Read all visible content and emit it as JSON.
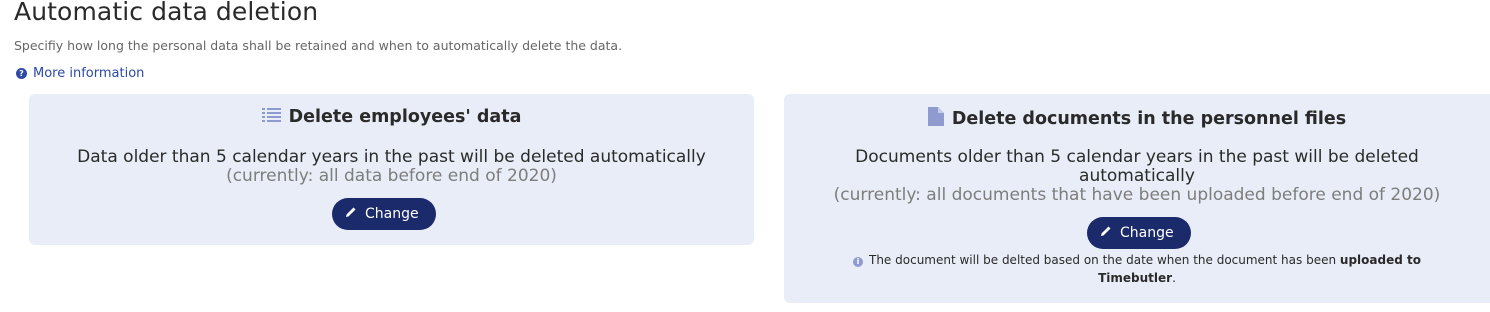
{
  "header": {
    "title": "Automatic data deletion",
    "subtitle": "Specifiy how long the personal data shall be retained and when to automatically delete the data.",
    "more_info_label": "More information",
    "more_info_icon": "question-circle-icon"
  },
  "cards": {
    "employees": {
      "icon": "list-icon",
      "title": "Delete employees' data",
      "rule_text": "Data older than 5 calendar years in the past will be deleted automatically",
      "current_text": "(currently: all data before end of 2020)",
      "change_label": "Change"
    },
    "documents": {
      "icon": "document-icon",
      "title": "Delete documents in the personnel files",
      "rule_line1": "Documents older than 5 calendar years in the past will be deleted",
      "rule_line2": "automatically",
      "current_text": "(currently: all documents that have been uploaded before end of 2020)",
      "change_label": "Change",
      "note_prefix": "The document will be delted based on the date when the document has been",
      "note_bold_1": "uploaded to",
      "note_bold_2": "Timebutler",
      "note_suffix": "."
    }
  },
  "colors": {
    "card_bg": "#e9edf7",
    "button_bg": "#1b2a6b",
    "link": "#2c4aa6",
    "icon_accent": "#8f9bcf"
  }
}
